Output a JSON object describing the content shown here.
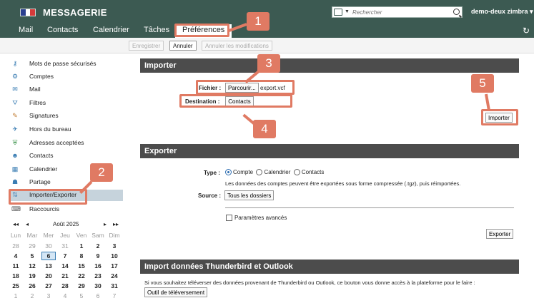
{
  "app": {
    "title": "MESSAGERIE",
    "user": "demo-deux zimbra"
  },
  "search": {
    "placeholder": "Rechercher"
  },
  "nav": {
    "tabs": [
      "Mail",
      "Contacts",
      "Calendrier",
      "Tâches",
      "Préférences"
    ]
  },
  "toolbar": {
    "save": "Enregistrer",
    "cancel": "Annuler",
    "cancel_mods": "Annuler les modifications"
  },
  "sidebar": {
    "items": [
      "Mots de passe sécurisés",
      "Comptes",
      "Mail",
      "Filtres",
      "Signatures",
      "Hors du bureau",
      "Adresses acceptées",
      "Contacts",
      "Calendrier",
      "Partage",
      "Importer/Exporter",
      "Raccourcis"
    ]
  },
  "calendar": {
    "month": "Août 2025",
    "weekdays": [
      "Lun",
      "Mar",
      "Mer",
      "Jeu",
      "Ven",
      "Sam",
      "Dim"
    ],
    "weeks": [
      [
        "28",
        "29",
        "30",
        "31",
        "1",
        "2",
        "3"
      ],
      [
        "4",
        "5",
        "6",
        "7",
        "8",
        "9",
        "10"
      ],
      [
        "11",
        "12",
        "13",
        "14",
        "15",
        "16",
        "17"
      ],
      [
        "18",
        "19",
        "20",
        "21",
        "22",
        "23",
        "24"
      ],
      [
        "25",
        "26",
        "27",
        "28",
        "29",
        "30",
        "31"
      ],
      [
        "1",
        "2",
        "3",
        "4",
        "5",
        "6",
        "7"
      ]
    ],
    "today": "6"
  },
  "import": {
    "title": "Importer",
    "file_label": "Fichier :",
    "browse": "Parcourir...",
    "file_name": "export.vcf",
    "dest_label": "Destination :",
    "dest_value": "Contacts",
    "button": "Importer"
  },
  "export": {
    "title": "Exporter",
    "type_label": "Type :",
    "options": [
      "Compte",
      "Calendrier",
      "Contacts"
    ],
    "note": "Les données des comptes peuvent être exportées sous forme compressée (.tgz), puis réimportées.",
    "source_label": "Source :",
    "source_button": "Tous les dossiers",
    "advanced": "Paramètres avancés",
    "button": "Exporter"
  },
  "thunderbird": {
    "title": "Import données Thunderbird et Outlook",
    "note": "Si vous souhaitez téléverser des données provenant de Thunderbird ou Outlook, ce bouton vous donne accès à la plateforme pour le faire :",
    "button": "Outil de téléversement"
  },
  "annotations": [
    "1",
    "2",
    "3",
    "4",
    "5"
  ],
  "colors": {
    "header": "#3c5a52",
    "annotation": "#e07a63",
    "section": "#4c4c4c",
    "selected": "#c6d3dc"
  }
}
